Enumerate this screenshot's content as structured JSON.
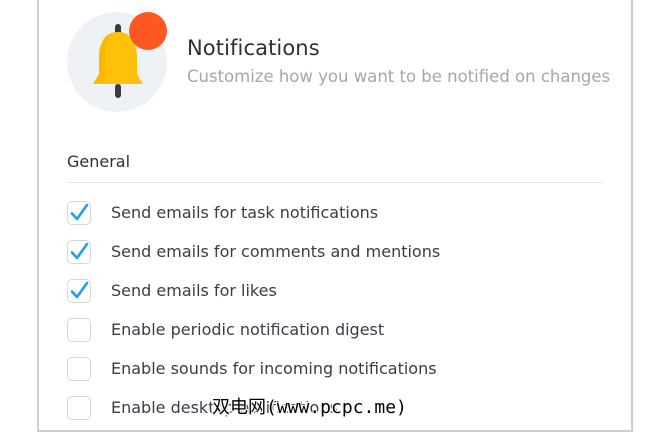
{
  "header": {
    "title": "Notifications",
    "subtitle": "Customize how you want to be notified on changes",
    "icon": "bell-icon",
    "badge_color": "#ff5722"
  },
  "section": {
    "title": "General"
  },
  "options": [
    {
      "label": "Send emails for task notifications",
      "checked": true
    },
    {
      "label": "Send emails for comments and mentions",
      "checked": true
    },
    {
      "label": "Send emails for likes",
      "checked": true
    },
    {
      "label": "Enable periodic notification digest",
      "checked": false
    },
    {
      "label": "Enable sounds for incoming notifications",
      "checked": false
    },
    {
      "label": "Enable desktop notifications",
      "checked": false
    }
  ],
  "colors": {
    "checkmark": "#1da1f2",
    "bell": "#ffc107"
  },
  "watermark": "双电网(www.pcpc.me)"
}
